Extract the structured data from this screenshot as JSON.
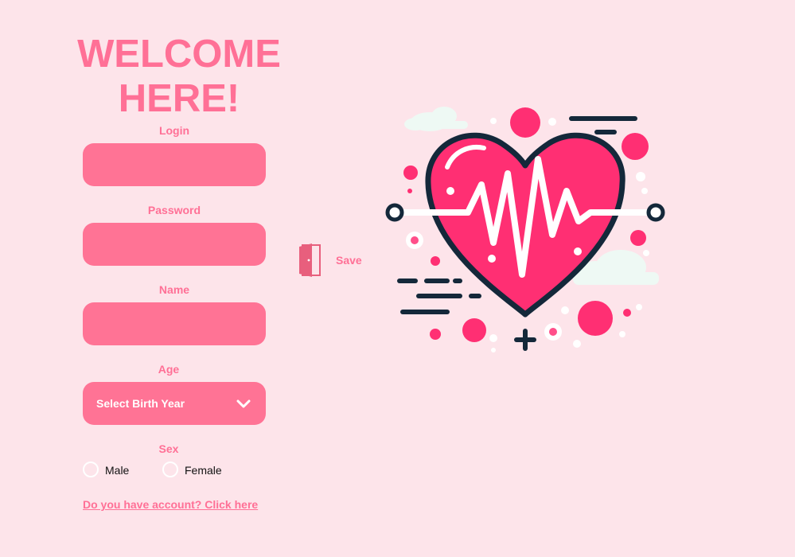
{
  "header": {
    "title_line1": "WELCOME",
    "title_line2": "HERE!"
  },
  "form": {
    "login_label": "Login",
    "password_label": "Password",
    "name_label": "Name",
    "age_label": "Age",
    "age_select_value": "Select Birth Year",
    "sex_label": "Sex",
    "sex_options": [
      "Male",
      "Female"
    ],
    "account_link": "Do you have account? Click here"
  },
  "actions": {
    "save_label": "Save",
    "save_icon": "door-icon"
  },
  "illustration": {
    "name": "heart-pulse-illustration"
  },
  "colors": {
    "background": "#fde4ea",
    "accent": "#ff7096",
    "field": "#ff7395"
  }
}
